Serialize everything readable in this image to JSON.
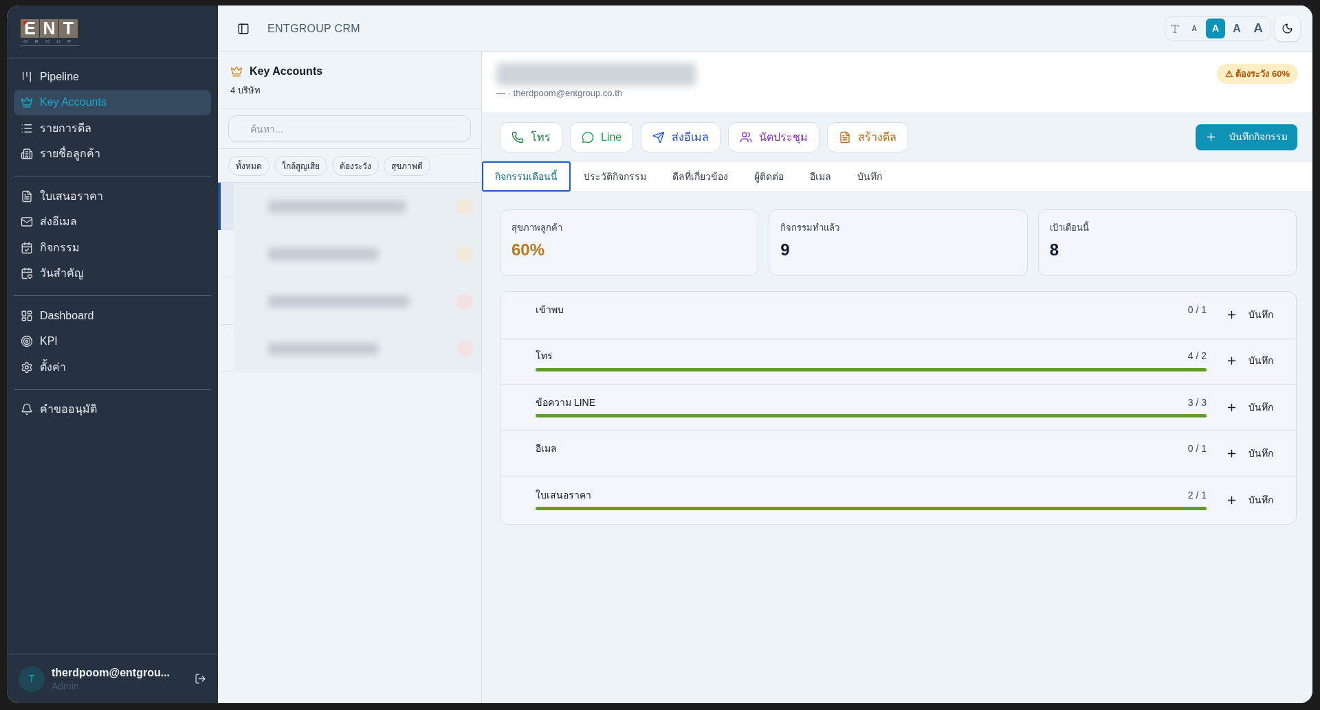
{
  "sidebar": {
    "logo": {
      "letters": [
        "E",
        "N",
        "T"
      ],
      "subtitle": "GROUP"
    },
    "sections": [
      {
        "items": [
          {
            "label": "Pipeline",
            "selected": false
          },
          {
            "label": "Key Accounts",
            "selected": true
          },
          {
            "label": "รายการดีล",
            "selected": false
          },
          {
            "label": "รายชื่อลูกค้า",
            "selected": false
          }
        ]
      },
      {
        "items": [
          {
            "label": "ใบเสนอราคา",
            "selected": false
          },
          {
            "label": "ส่งอีเมล",
            "selected": false
          },
          {
            "label": "กิจกรรม",
            "selected": false
          },
          {
            "label": "วันสำคัญ",
            "selected": false
          }
        ]
      },
      {
        "items": [
          {
            "label": "Dashboard",
            "selected": false
          },
          {
            "label": "KPI",
            "selected": false
          },
          {
            "label": "ตั้งค่า",
            "selected": false
          }
        ]
      },
      {
        "items": [
          {
            "label": "คำขออนุมัติ",
            "selected": false
          }
        ]
      }
    ],
    "user": {
      "initial": "T",
      "name": "therdpoom@entgrou...",
      "role": "Admin"
    }
  },
  "top_bar": {
    "title": "ENTGROUP CRM",
    "font_sizes": [
      {
        "label": "A",
        "selected": false
      },
      {
        "label": "A",
        "selected": true
      },
      {
        "label": "A",
        "selected": false
      },
      {
        "label": "A",
        "selected": false
      }
    ]
  },
  "account_list": {
    "title": "Key Accounts",
    "count": "4 บริษัท",
    "search": {
      "placeholder": "ค้นหา..."
    },
    "filters": [
      {
        "label": "ทั้งหมด",
        "selected": false
      },
      {
        "label": "ใกล้สูญเสีย",
        "selected": false
      },
      {
        "label": "ต้องระวัง",
        "selected": false
      },
      {
        "label": "สุขภาพดี",
        "selected": false
      }
    ],
    "rows": [
      {
        "selected": true,
        "color": "#f3e9d9"
      },
      {
        "selected": false,
        "color": "#f1eadb"
      },
      {
        "selected": false,
        "color": "#f4e2e2"
      },
      {
        "selected": false,
        "color": "#f4e2e2"
      }
    ]
  },
  "detail": {
    "contact": "— · therdpoom@entgroup.co.th",
    "badge": "⚠ ต้องระวัง 60%",
    "actions": [
      {
        "label": "โทร",
        "color": "#15803d"
      },
      {
        "label": "Line",
        "color": "#16a34a"
      },
      {
        "label": "ส่งอีเมล",
        "color": "#1d4ed8"
      },
      {
        "label": "นัดประชุม",
        "color": "#8b2fc9"
      },
      {
        "label": "สร้างดีล",
        "color": "#c2670f"
      }
    ],
    "primary_action": "บันทึกกิจกรรม",
    "tabs": [
      {
        "label": "กิจกรรมเดือนนี้",
        "selected": true
      },
      {
        "label": "ประวัติกิจกรรม",
        "selected": false
      },
      {
        "label": "ดีลที่เกี่ยวข้อง",
        "selected": false
      },
      {
        "label": "ผู้ติดต่อ",
        "selected": false
      },
      {
        "label": "อีเมล",
        "selected": false
      },
      {
        "label": "บันทึก",
        "selected": false
      }
    ],
    "stats": [
      {
        "label": "สุขภาพลูกค้า",
        "value": "60%",
        "color": "#b7791f"
      },
      {
        "label": "กิจกรรมทำแล้ว",
        "value": "9",
        "color": "#0f172a"
      },
      {
        "label": "เป้าเดือนนี้",
        "value": "8",
        "color": "#0f172a"
      }
    ],
    "activities": [
      {
        "name": "เข้าพบ",
        "count": "0 / 1",
        "action": "บันทึก"
      },
      {
        "name": "โทร",
        "count": "4 / 2",
        "level": 1,
        "action": "บันทึก"
      },
      {
        "name": "ข้อความ LINE",
        "count": "3 / 3",
        "level": 1,
        "action": "บันทึก"
      },
      {
        "name": "อีเมล",
        "count": "0 / 1",
        "action": "บันทึก"
      },
      {
        "name": "ใบเสนอราคา",
        "count": "2 / 1",
        "level": 1,
        "action": "บันทึก"
      }
    ]
  }
}
